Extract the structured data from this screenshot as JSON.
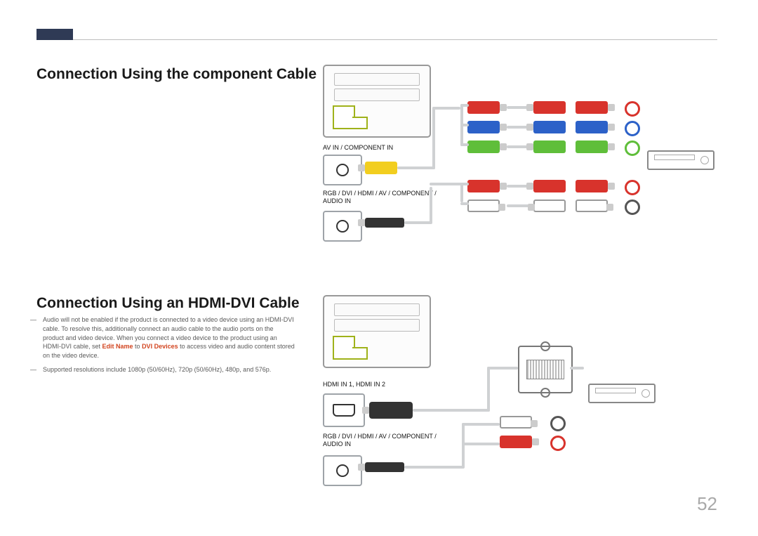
{
  "page_number": "52",
  "section1": {
    "title": "Connection Using the component Cable",
    "labels": {
      "av_in": "AV IN / COMPONENT IN",
      "audio_in": "RGB / DVI / HDMI / AV / COMPONENT / AUDIO IN"
    }
  },
  "section2": {
    "title": "Connection Using an HDMI-DVI Cable",
    "labels": {
      "hdmi_in": "HDMI IN 1, HDMI IN 2",
      "audio_in": "RGB / DVI / HDMI / AV / COMPONENT / AUDIO IN"
    },
    "notes": {
      "n1_pre": "Audio will not be enabled if the product is connected to a video device using an HDMI-DVI cable. To resolve this, additionally connect an audio cable to the audio ports on the product and video device. When you connect a video device to the product using an HDMI-DVI cable, set ",
      "n1_hl1": "Edit Name",
      "n1_mid": " to ",
      "n1_hl2": "DVI Devices",
      "n1_post": " to access video and audio content stored on the video device.",
      "n2": "Supported resolutions include 1080p (50/60Hz), 720p (50/60Hz), 480p, and 576p."
    }
  },
  "colors": {
    "accent": "#d2441f",
    "header_bar": "#2f3a55"
  }
}
